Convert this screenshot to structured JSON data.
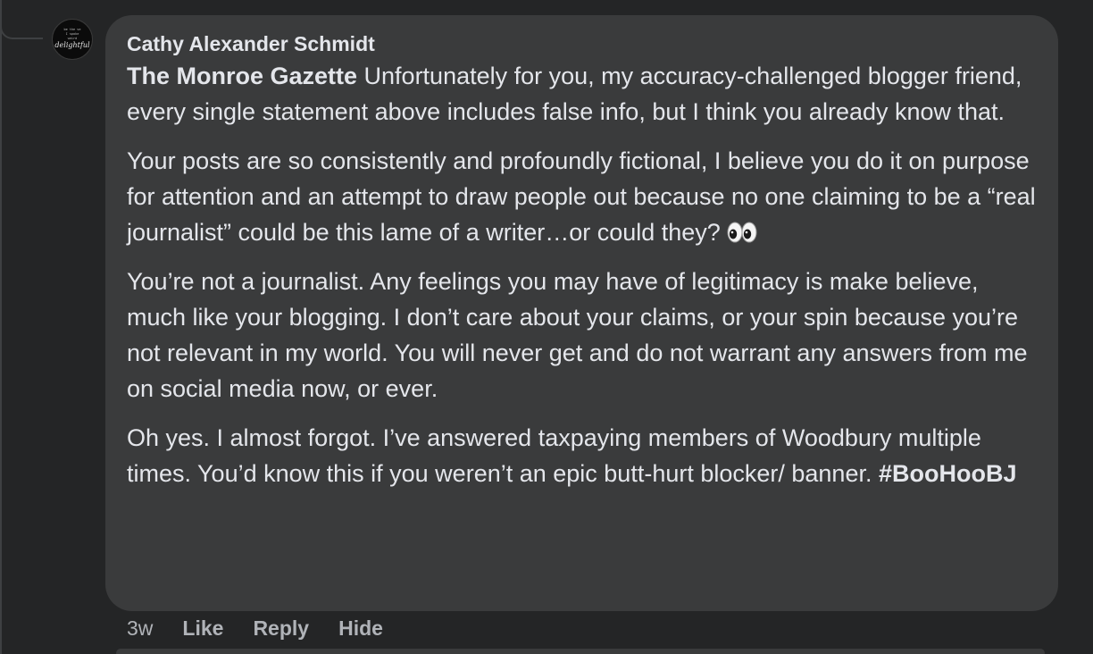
{
  "comment": {
    "author": "Cathy Alexander Schmidt",
    "avatar": {
      "tiny_lines": [
        "be the ve",
        "I spoke",
        "weird"
      ],
      "script_word": "delightful"
    },
    "paragraph1": {
      "mention": "The Monroe Gazette",
      "text": " Unfortunately for you, my accuracy-challenged blogger friend, every single statement above includes false info, but I think you already know that."
    },
    "paragraph2": {
      "text": "Your posts are so consistently and profoundly fictional, I believe you do it on purpose for attention and an attempt to draw people out because no one claiming to be a “real journalist” could be this lame of a writer…or could they? ",
      "emoji": "eyes-emoji"
    },
    "paragraph3": {
      "text": "You’re not a journalist. Any feelings you may have of legitimacy is make believe, much like your blogging. I don’t care about your claims, or your spin because you’re not relevant in my world. You will never get and do not warrant any answers from me on social media now, or ever."
    },
    "paragraph4": {
      "text": "Oh yes. I almost forgot. I’ve answered taxpaying members of Woodbury multiple times. You’d know this if you weren’t an epic butt-hurt blocker/ banner. ",
      "hashtag": "#BooHooBJ"
    }
  },
  "actions": {
    "time": "3w",
    "like": "Like",
    "reply": "Reply",
    "hide": "Hide"
  },
  "colors": {
    "background": "#242526",
    "bubble": "#3a3b3c",
    "text": "#e4e6eb",
    "secondary_text": "#b0b3b8"
  }
}
